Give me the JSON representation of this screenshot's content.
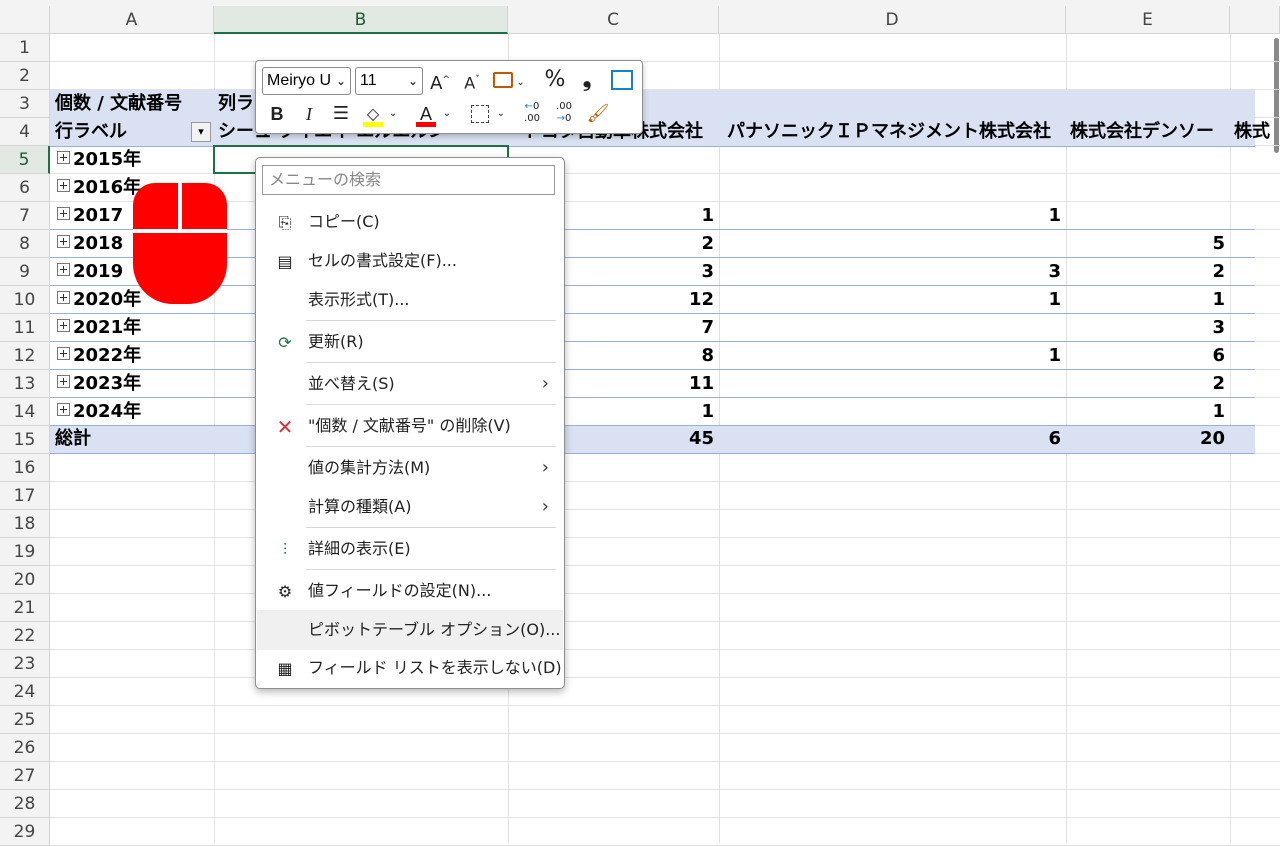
{
  "columns": [
    "A",
    "B",
    "C",
    "D",
    "E"
  ],
  "rows": [
    "1",
    "2",
    "3",
    "4",
    "5",
    "6",
    "7",
    "8",
    "9",
    "10",
    "11",
    "12",
    "13",
    "14",
    "15",
    "16",
    "17",
    "18",
    "19",
    "20",
    "21",
    "22",
    "23",
    "24",
    "25",
    "26",
    "27",
    "28",
    "29"
  ],
  "pivot": {
    "value_header": "個数 / 文献番号",
    "col_label_header": "列ラ",
    "row_label_header": "行ラベル",
    "col_headers": {
      "b": "シーュ ブイエイ エルエルン",
      "c": "トヨタ自動車株式会社",
      "d": "パナソニックＩＰマネジメント株式会社",
      "e": "株式会社デンソー",
      "f": "株式"
    },
    "row_items": [
      "2015年",
      "2016年",
      "2017年",
      "2018年",
      "2019年",
      "2020年",
      "2021年",
      "2022年",
      "2023年",
      "2024年"
    ],
    "row_labels_visible": [
      "2015年",
      "2016年",
      "2017",
      "2018",
      "2019",
      "2020年",
      "2021年",
      "2022年",
      "2023年",
      "2024年"
    ],
    "col_c_values": [
      "",
      "",
      "1",
      "2",
      "3",
      "12",
      "7",
      "8",
      "11",
      "1"
    ],
    "col_d_values": [
      "",
      "",
      "1",
      "",
      "3",
      "1",
      "",
      "1",
      "",
      ""
    ],
    "col_e_values": [
      "",
      "",
      "",
      "5",
      "2",
      "1",
      "3",
      "6",
      "2",
      "1"
    ],
    "total_label": "総計",
    "totals": {
      "c": "45",
      "d": "6",
      "e": "20"
    }
  },
  "mini_toolbar": {
    "font_name": "Meiryo U",
    "font_size": "11",
    "grow_font": "A",
    "shrink_font": "A",
    "percent": "%",
    "comma": "❟",
    "bold": "B",
    "italic": "I",
    "font_color_letter": "A"
  },
  "context_menu": {
    "search_placeholder": "メニューの検索",
    "items": [
      {
        "label": "コピー(C)",
        "icon": "copy-icon"
      },
      {
        "label": "セルの書式設定(F)...",
        "icon": "format-cells-icon"
      },
      {
        "label": "表示形式(T)...",
        "icon": ""
      },
      {
        "label": "更新(R)",
        "icon": "refresh-icon"
      },
      {
        "label": "並べ替え(S)",
        "icon": "",
        "submenu": true
      },
      {
        "label": "\"個数 / 文献番号\" の削除(V)",
        "icon": "delete-icon"
      },
      {
        "label": "値の集計方法(M)",
        "icon": "",
        "submenu": true
      },
      {
        "label": "計算の種類(A)",
        "icon": "",
        "submenu": true
      },
      {
        "label": "詳細の表示(E)",
        "icon": "show-details-icon"
      },
      {
        "label": "値フィールドの設定(N)...",
        "icon": "value-field-settings-icon"
      },
      {
        "label": "ピボットテーブル オプション(O)...",
        "icon": ""
      },
      {
        "label": "フィールド リストを表示しない(D)",
        "icon": "field-list-icon"
      }
    ]
  },
  "colors": {
    "pivot_band": "#d9e1f2",
    "accent": "#1e7145",
    "mouse": "#ff0000",
    "delete": "#d13438"
  }
}
